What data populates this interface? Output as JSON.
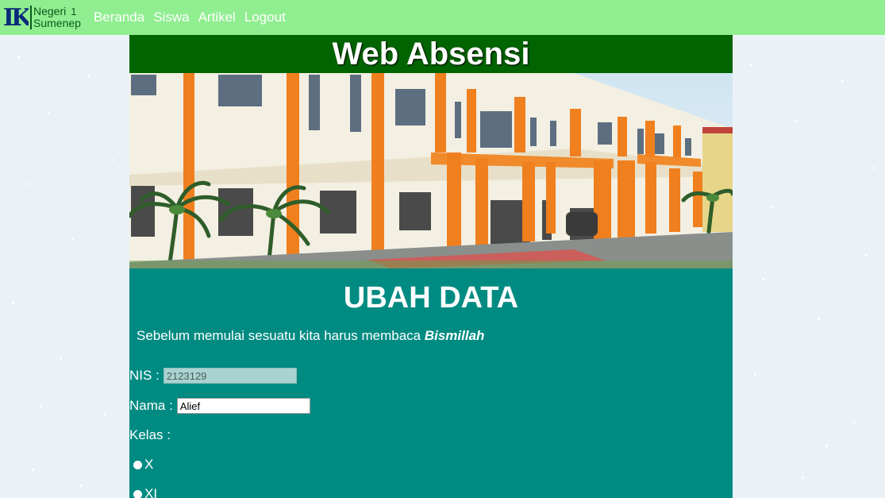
{
  "navbar": {
    "logo": {
      "mark": "IK",
      "line1": "Negeri",
      "num": "1",
      "line2": "Sumenep"
    },
    "links": [
      "Beranda",
      "Siswa",
      "Artikel",
      "Logout"
    ]
  },
  "header": {
    "title": "Web Absensi"
  },
  "main": {
    "title": "UBAH DATA",
    "intro_text": "Sebelum memulai sesuatu kita harus membaca ",
    "intro_bold": "Bismillah",
    "form": {
      "nis_label": "NIS :",
      "nis_value": "2123129",
      "nama_label": "Nama :",
      "nama_value": "Alief",
      "kelas_label": "Kelas :",
      "kelas_options": [
        "X",
        "XI"
      ]
    }
  },
  "colors": {
    "navbar": "#90ee90",
    "header": "#006400",
    "content": "#008b82"
  }
}
